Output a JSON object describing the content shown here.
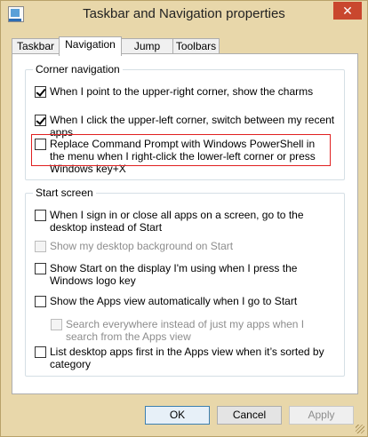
{
  "window": {
    "title": "Taskbar and Navigation properties",
    "close_label": "✕"
  },
  "tabs": [
    {
      "label": "Taskbar",
      "active": false
    },
    {
      "label": "Navigation",
      "active": true
    },
    {
      "label": "Jump Lists",
      "active": false
    },
    {
      "label": "Toolbars",
      "active": false
    }
  ],
  "corner_navigation": {
    "legend": "Corner navigation",
    "options": [
      {
        "label": "When I point to the upper-right corner, show the charms",
        "checked": true,
        "enabled": true
      },
      {
        "label": "When I click the upper-left corner, switch between my recent apps",
        "checked": true,
        "enabled": true
      },
      {
        "label": "Replace Command Prompt with Windows PowerShell in the menu when I right-click the lower-left corner or press Windows key+X",
        "checked": false,
        "enabled": true
      }
    ]
  },
  "start_screen": {
    "legend": "Start screen",
    "options": [
      {
        "label": "When I sign in or close all apps on a screen, go to the desktop instead of Start",
        "checked": false,
        "enabled": true
      },
      {
        "label": "Show my desktop background on Start",
        "checked": false,
        "enabled": false
      },
      {
        "label": "Show Start on the display I'm using when I press the Windows logo key",
        "checked": false,
        "enabled": true
      },
      {
        "label": "Show the Apps view automatically when I go to Start",
        "checked": false,
        "enabled": true
      },
      {
        "label": "Search everywhere instead of just my apps when I search from the Apps view",
        "checked": false,
        "enabled": false
      },
      {
        "label": "List desktop apps first in the Apps view when it’s sorted by category",
        "checked": false,
        "enabled": true
      }
    ]
  },
  "buttons": {
    "ok": "OK",
    "cancel": "Cancel",
    "apply": "Apply"
  }
}
